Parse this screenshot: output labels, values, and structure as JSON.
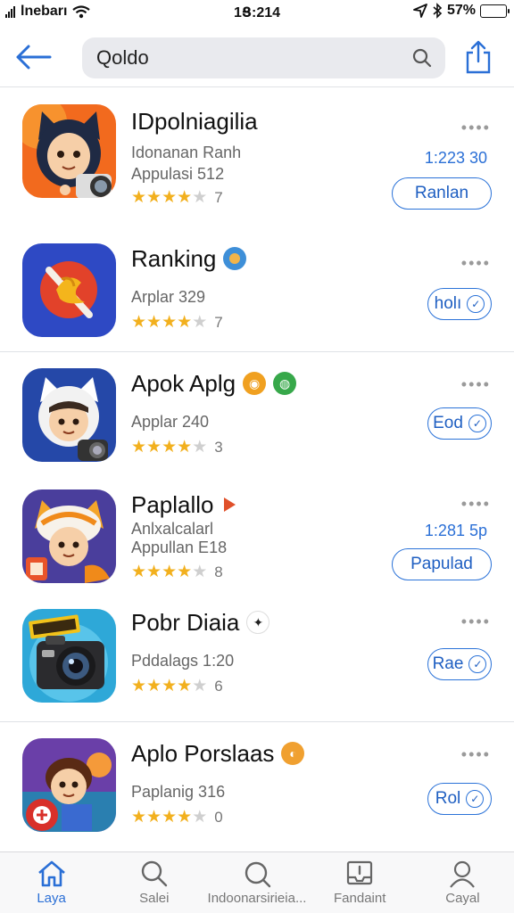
{
  "status": {
    "carrier": "lnebarı",
    "time": "1Ց:214",
    "battery": "57%",
    "battery_level": 0.57
  },
  "nav": {
    "search_value": "Qoldo",
    "back_icon": "arrow-left-icon",
    "share_icon": "share-icon",
    "search_icon": "search-icon"
  },
  "apps": [
    {
      "name": "IDpolniagilia",
      "line1": "Idonanan Ranh",
      "line2": "Appulasi 512",
      "stars": 4.5,
      "rating_count": "7",
      "price": "1:223 30",
      "action": "Ranlan"
    },
    {
      "name": "Ranking",
      "line1": "",
      "line2": "Arplar 329",
      "stars": 4.5,
      "rating_count": "7",
      "price": "",
      "action": "holı"
    },
    {
      "name": "Apok Aplg",
      "line1": "",
      "line2": "Applar 240",
      "stars": 4,
      "rating_count": "3",
      "price": "",
      "action": "Eod"
    },
    {
      "name": "Paplallo",
      "line1": "Anlxalcalarl",
      "line2": "Appullan E18",
      "stars": 4,
      "rating_count": "8",
      "price": "1:281 5p",
      "action": "Papulad"
    },
    {
      "name": "Pobr Diaia",
      "line1": "",
      "line2": "Pddalags 1:20",
      "stars": 4.5,
      "rating_count": "6",
      "price": "",
      "action": "Rae"
    },
    {
      "name": "Aplo Porslaas",
      "line1": "",
      "line2": "Paplanig 316",
      "stars": 4.5,
      "rating_count": "0",
      "price": "",
      "action": "Rol"
    }
  ],
  "tabs": [
    {
      "label": "Laya",
      "icon": "home-icon",
      "active": true
    },
    {
      "label": "Salei",
      "icon": "search-icon",
      "active": false
    },
    {
      "label": "Indoonarsirieia...",
      "icon": "search-icon",
      "active": false
    },
    {
      "label": "Fandaint",
      "icon": "inbox-icon",
      "active": false
    },
    {
      "label": "Cayal",
      "icon": "person-icon",
      "active": false
    }
  ],
  "colors": {
    "accent": "#2a6fd6",
    "star": "#f2b01e"
  }
}
